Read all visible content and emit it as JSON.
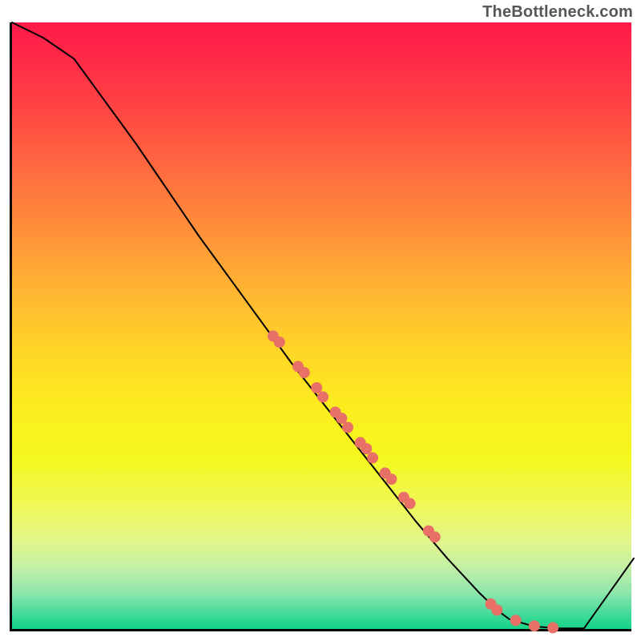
{
  "attribution": "TheBottleneck.com",
  "colors": {
    "curve": "#000000",
    "marker": "#e87066",
    "axis": "#000000"
  },
  "chart_data": {
    "type": "line",
    "title": "",
    "xlabel": "",
    "ylabel": "",
    "xlim": [
      0,
      100
    ],
    "ylim": [
      0,
      100
    ],
    "note": "No axis ticks or numeric labels are rendered; values are normalized 0–100 estimates from pixel positions.",
    "series": [
      {
        "name": "curve",
        "x": [
          0,
          5,
          10,
          15,
          20,
          25,
          30,
          35,
          40,
          45,
          50,
          55,
          60,
          65,
          70,
          75,
          78,
          80,
          84,
          88,
          92,
          100
        ],
        "y": [
          100,
          97.5,
          94,
          87,
          80,
          72.5,
          65,
          58,
          51,
          44,
          37.5,
          31,
          24.5,
          18,
          12,
          6.5,
          3.5,
          2,
          0.8,
          0.5,
          0.5,
          12
        ]
      }
    ],
    "markers": {
      "name": "highlighted-points",
      "x": [
        42,
        43,
        46,
        47,
        49,
        50,
        52,
        53,
        54,
        56,
        57,
        58,
        60,
        61,
        63,
        64,
        67,
        68,
        77,
        78,
        81,
        84,
        87
      ],
      "y": [
        48.5,
        47.5,
        43.5,
        42.5,
        40,
        38.5,
        36,
        35,
        33.5,
        31,
        30,
        28.5,
        26,
        25,
        22,
        21,
        16.5,
        15.5,
        4.5,
        3.5,
        1.8,
        0.9,
        0.6
      ]
    }
  }
}
